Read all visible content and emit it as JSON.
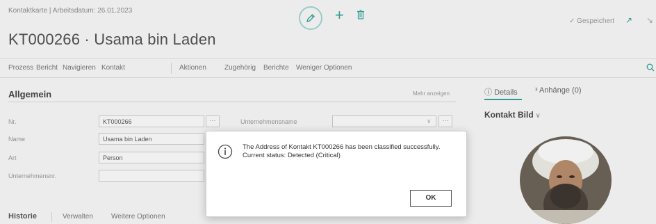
{
  "header": {
    "breadcrumb": "Kontaktkarte | Arbeitsdatum: 26.01.2023",
    "title": "KT000266 · Usama bin Laden",
    "saved_status": "✓ Gespeichert",
    "toolbar_icons": [
      "edit-icon",
      "plus-icon",
      "trash-icon",
      "open-new-window-icon",
      "collapse-icon"
    ]
  },
  "actions": {
    "items": [
      "Prozess",
      "Bericht",
      "Navigieren",
      "Kontakt",
      "Aktionen",
      "Zugehörig",
      "Berichte",
      "Weniger Optionen"
    ]
  },
  "general": {
    "title": "Allgemein",
    "show_more": "Mehr anzeigen",
    "fields": [
      {
        "label": "Nr.",
        "value": "KT000266"
      },
      {
        "label": "Name",
        "value": "Usama bin Laden"
      },
      {
        "label": "Art",
        "value": "Person"
      },
      {
        "label": "Unternehmensnr.",
        "value": ""
      }
    ],
    "company_label": "Unternehmensname"
  },
  "factbox": {
    "tab_details": "Details",
    "tab_attachments": "Anhänge (0)",
    "picture_title": "Kontakt Bild"
  },
  "bottom_tabs": {
    "items": [
      "Historie",
      "Verwalten",
      "Weitere Optionen"
    ]
  },
  "dialog": {
    "message_line1": "The Address of Kontakt KT000266 has been classified successfully.",
    "message_line2": "Current status: Detected (Critical)",
    "ok_label": "OK"
  },
  "colors": {
    "accent": "#2fa39b",
    "accent_light": "#9fd8d4"
  }
}
